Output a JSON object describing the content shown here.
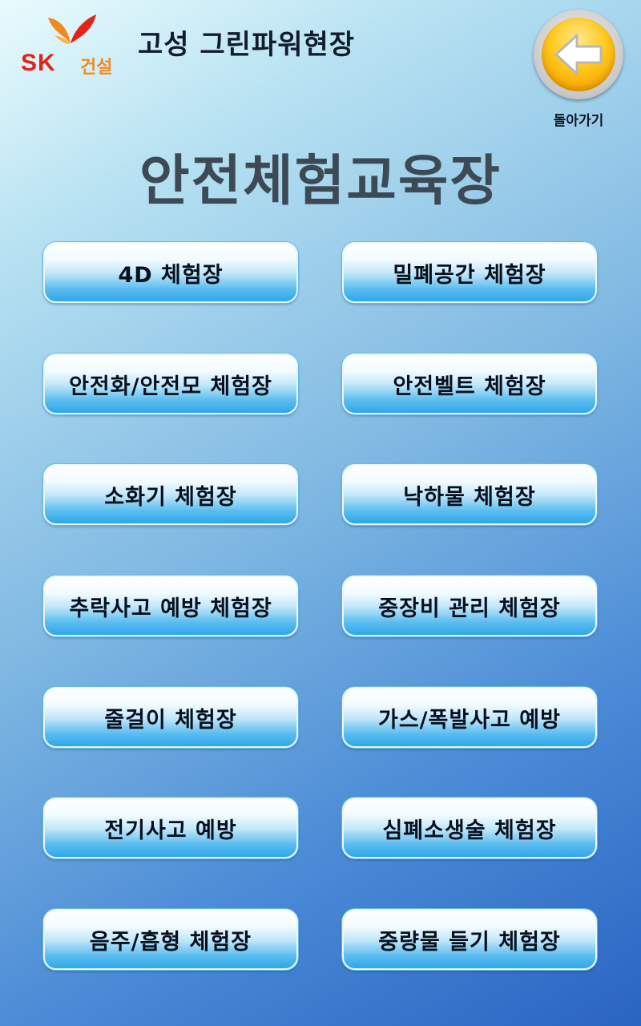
{
  "header": {
    "logo": {
      "brand": "SK",
      "division": "건설",
      "brand_color": "#e2231a",
      "division_color": "#f08a1e"
    },
    "site_title": "고성 그린파워현장",
    "back_button": {
      "label": "돌아가기",
      "icon": "arrow-left-icon",
      "color": "#ffc81a"
    }
  },
  "main": {
    "title": "안전체험교육장",
    "buttons": [
      {
        "label": "4D 체험장"
      },
      {
        "label": "밀폐공간 체험장"
      },
      {
        "label": "안전화/안전모 체험장"
      },
      {
        "label": "안전벨트 체험장"
      },
      {
        "label": "소화기 체험장"
      },
      {
        "label": "낙하물 체험장"
      },
      {
        "label": "추락사고 예방 체험장"
      },
      {
        "label": "중장비 관리 체험장"
      },
      {
        "label": "줄걸이 체험장"
      },
      {
        "label": "가스/폭발사고 예방"
      },
      {
        "label": "전기사고 예방"
      },
      {
        "label": "심폐소생술 체험장"
      },
      {
        "label": "음주/흡형 체험장"
      },
      {
        "label": "중량물 들기 체험장"
      }
    ]
  }
}
